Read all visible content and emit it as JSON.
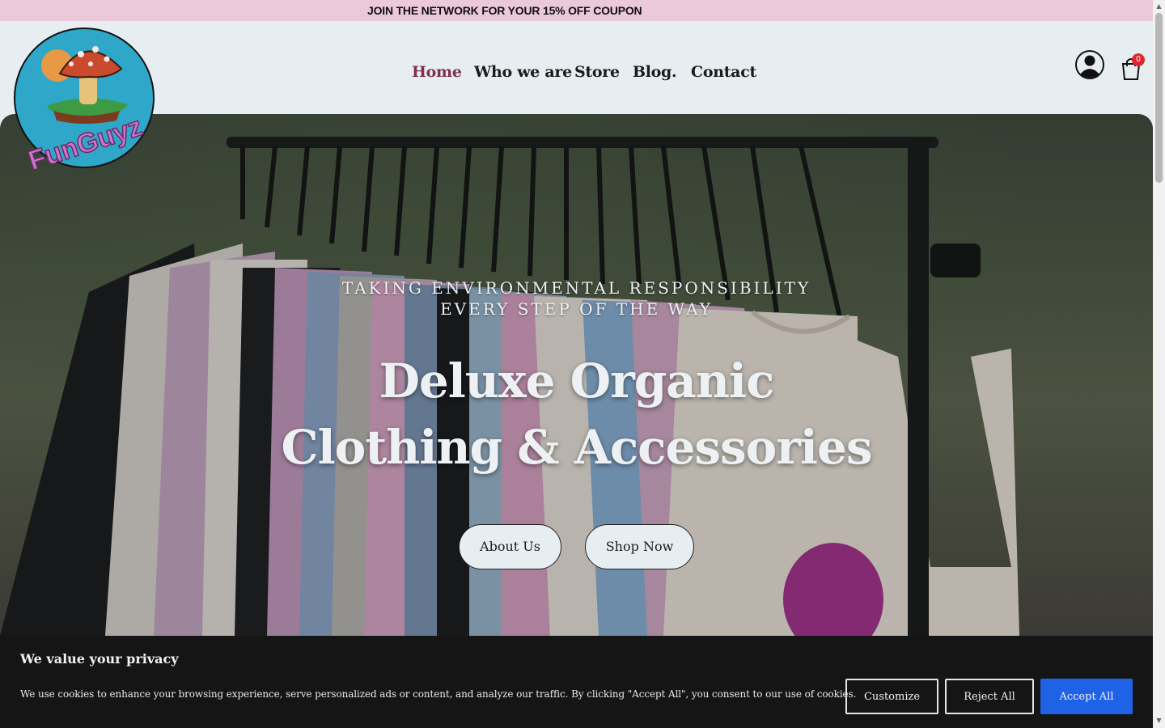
{
  "promo": {
    "text": "JOIN THE NETWORK FOR YOUR 15% OFF COUPON"
  },
  "brand": {
    "logo_text": "FunGuyz",
    "logo_icon": "mushroom-logo-icon"
  },
  "nav": {
    "items": [
      {
        "label": "Home",
        "active": true
      },
      {
        "label": "Who we are",
        "active": false
      },
      {
        "label": "Store",
        "active": false
      },
      {
        "label": "Blog.",
        "active": false
      },
      {
        "label": "Contact",
        "active": false
      }
    ]
  },
  "header_actions": {
    "account_icon": "user-account-icon",
    "cart_icon": "shopping-bag-icon",
    "cart_count": "0"
  },
  "hero": {
    "eyebrow_line1": "TAKING ENVIRONMENTAL RESPONSIBILITY",
    "eyebrow_line2": "EVERY STEP OF THE WAY",
    "title_line1": "Deluxe Organic",
    "title_line2": "Clothing & Accessories",
    "btn_about": "About Us",
    "btn_shop": "Shop Now",
    "background": "clothing-rack-photo"
  },
  "cookie": {
    "title": "We value your privacy",
    "text": "We use cookies to enhance your browsing experience, serve personalized ads or content, and analyze our traffic. By clicking \"Accept All\", you consent to our use of cookies.",
    "customize": "Customize",
    "reject": "Reject All",
    "accept": "Accept All"
  },
  "colors": {
    "promo_bg": "#ebc8dc",
    "header_bg": "#e7eef1",
    "nav_active": "#7d2f55",
    "accept_blue": "#1f62e6",
    "cookie_bg": "#151515",
    "badge_red": "#e3262e"
  }
}
